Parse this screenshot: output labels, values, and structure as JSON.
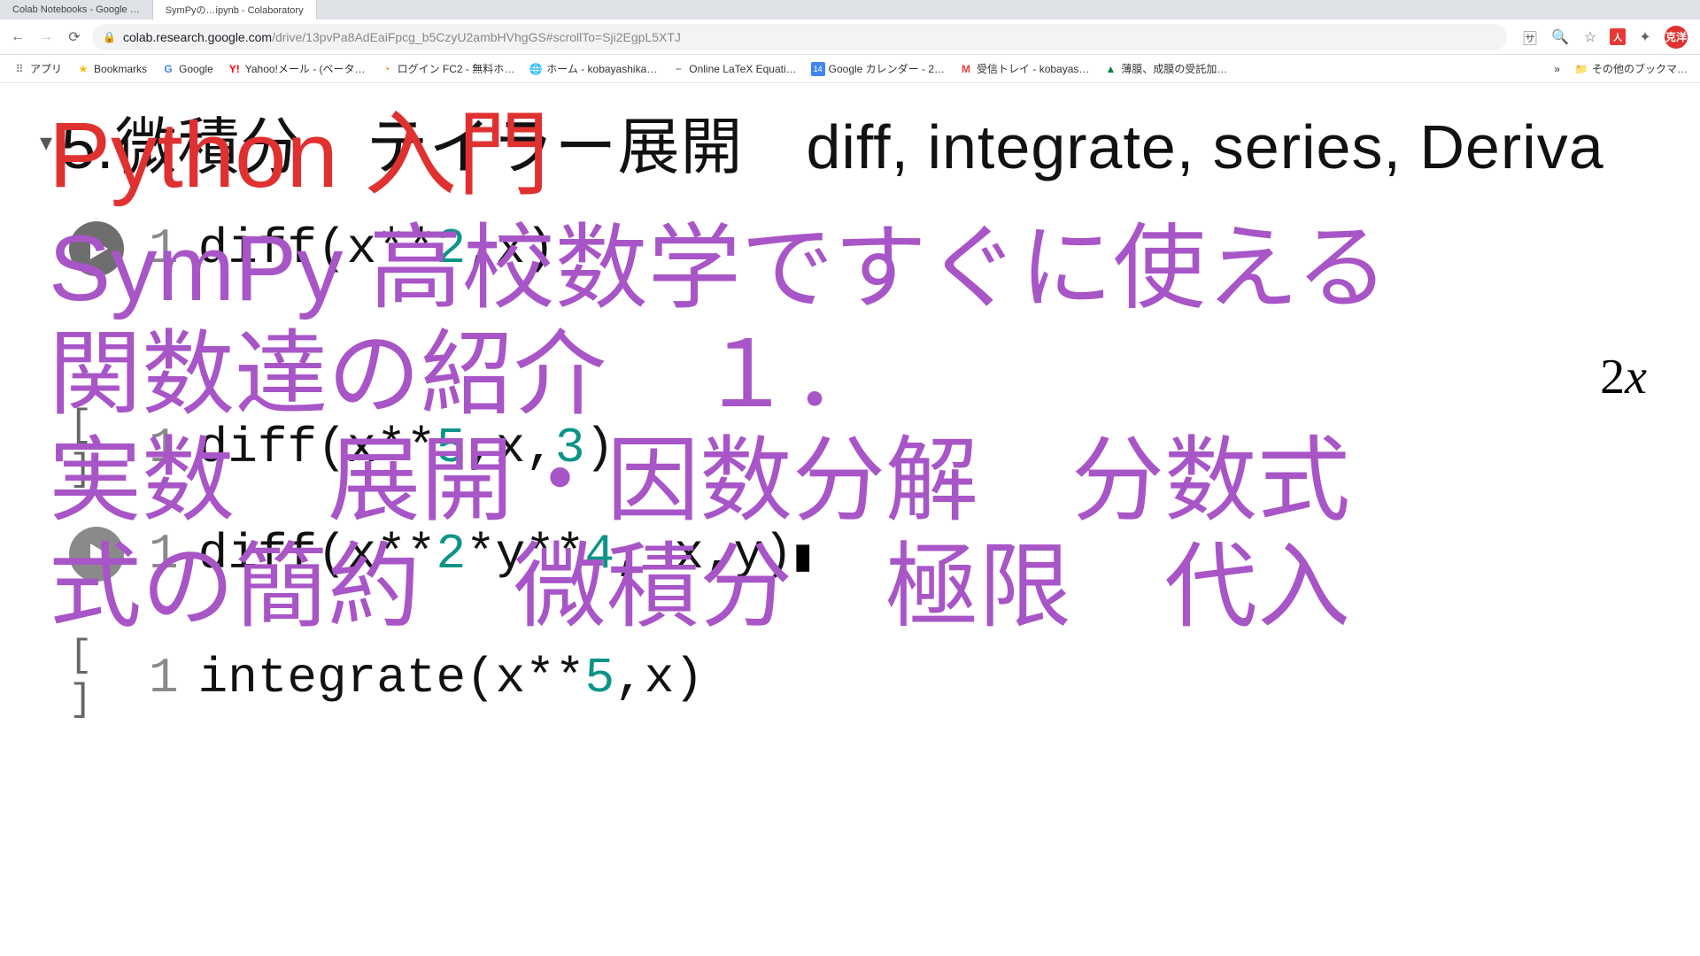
{
  "tabs": [
    {
      "title": "Colab Notebooks - Google …"
    },
    {
      "title": "SymPyの…ipynb - Colaboratory"
    }
  ],
  "nav": {
    "url_host": "colab.research.google.com",
    "url_path": "/drive/13pvPa8AdEaiFpcg_b5CzyU2ambHVhgGS#scrollTo=Sji2EgpL5XTJ",
    "avatar": "克洋"
  },
  "bookmarks": {
    "apps": "アプリ",
    "items": [
      {
        "icon": "star",
        "label": "Bookmarks"
      },
      {
        "icon": "google",
        "label": "Google"
      },
      {
        "icon": "yahoo",
        "label": "Yahoo!メール - (ベータ…"
      },
      {
        "icon": "fc2",
        "label": "ログイン FC2 - 無料ホ…"
      },
      {
        "icon": "globe",
        "label": "ホーム - kobayashika…"
      },
      {
        "icon": "latex",
        "label": "Online LaTeX Equati…"
      },
      {
        "icon": "cal",
        "label": "Google カレンダー - 2…"
      },
      {
        "icon": "gmail",
        "label": "受信トレイ - kobayas…"
      },
      {
        "icon": "green",
        "label": "薄膜、成膜の受託加…"
      }
    ],
    "more": "»",
    "other": "その他のブックマ…"
  },
  "heading": "5.微積分　テイラー展開　diff, integrate, series, Deriva",
  "cells": [
    {
      "type": "run",
      "line": "1",
      "code_parts": [
        "diff(x**",
        "2",
        ",x)"
      ],
      "output": "2x"
    },
    {
      "type": "empty",
      "line": "1",
      "code_parts": [
        "diff(x**",
        "5",
        ",x,",
        "3",
        ")"
      ]
    },
    {
      "type": "run",
      "line": "1",
      "code_parts": [
        "diff(x**",
        "2",
        "*y**",
        "4",
        ", x,y)"
      ]
    },
    {
      "type": "empty",
      "line": "1",
      "code_parts": [
        "integrate(x**",
        "5",
        ",x)"
      ]
    }
  ],
  "overlay": {
    "line1": "Python 入門",
    "line2": "SymPy 高校数学ですぐに使える",
    "line3": "関数達の紹介　１．",
    "line4": "実数　展開・因数分解　分数式",
    "line5": "式の簡約　微積分　極限　代入"
  }
}
